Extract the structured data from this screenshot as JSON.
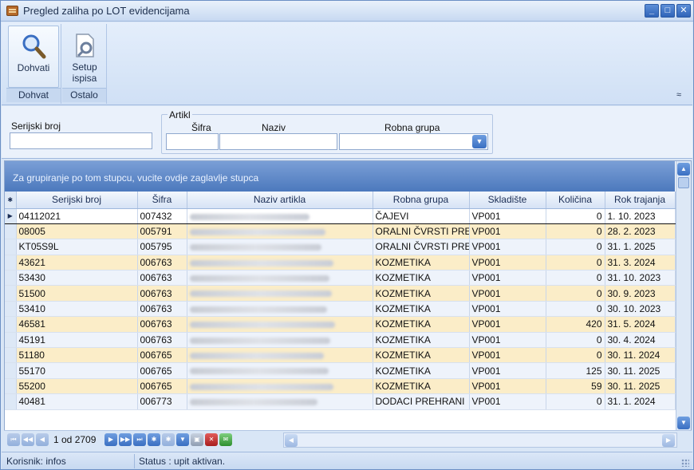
{
  "window": {
    "title": "Pregled zaliha po LOT evidencijama"
  },
  "ribbon": {
    "groups": [
      {
        "label": "Dohvat",
        "buttons": [
          {
            "label": "Dohvati",
            "icon": "magnifier-icon"
          }
        ]
      },
      {
        "label": "Ostalo",
        "buttons": [
          {
            "label": "Setup ispisa",
            "icon": "page-setup-icon"
          }
        ]
      }
    ],
    "collapse_glyph": "≈"
  },
  "filters": {
    "serijski_label": "Serijski broj",
    "serijski_value": "",
    "artikl_label": "Artikl",
    "sifra_label": "Šifra",
    "sifra_value": "",
    "naziv_label": "Naziv",
    "naziv_value": "",
    "grupa_label": "Robna grupa",
    "grupa_value": ""
  },
  "grid": {
    "group_hint": "Za grupiranje po tom stupcu, vucite ovdje zaglavlje stupca",
    "columns": [
      "Serijski broj",
      "Šifra",
      "Naziv artikla",
      "Robna grupa",
      "Skladište",
      "Količina",
      "Rok trajanja"
    ],
    "rows": [
      {
        "serijski": "04112021",
        "sifra": "007432",
        "grupa": "ČAJEVI",
        "skladiste": "VP001",
        "kolicina": "0",
        "rok": "1. 10. 2023"
      },
      {
        "serijski": "08005",
        "sifra": "005791",
        "grupa": "ORALNI ČVRSTI PREPA",
        "skladiste": "VP001",
        "kolicina": "0",
        "rok": "28. 2. 2023"
      },
      {
        "serijski": "KT05S9L",
        "sifra": "005795",
        "grupa": "ORALNI ČVRSTI PREPA",
        "skladiste": "VP001",
        "kolicina": "0",
        "rok": "31. 1. 2025"
      },
      {
        "serijski": "43621",
        "sifra": "006763",
        "grupa": "KOZMETIKA",
        "skladiste": "VP001",
        "kolicina": "0",
        "rok": "31. 3. 2024"
      },
      {
        "serijski": "53430",
        "sifra": "006763",
        "grupa": "KOZMETIKA",
        "skladiste": "VP001",
        "kolicina": "0",
        "rok": "31. 10. 2023"
      },
      {
        "serijski": "51500",
        "sifra": "006763",
        "grupa": "KOZMETIKA",
        "skladiste": "VP001",
        "kolicina": "0",
        "rok": "30. 9. 2023"
      },
      {
        "serijski": "53410",
        "sifra": "006763",
        "grupa": "KOZMETIKA",
        "skladiste": "VP001",
        "kolicina": "0",
        "rok": "30. 10. 2023"
      },
      {
        "serijski": "46581",
        "sifra": "006763",
        "grupa": "KOZMETIKA",
        "skladiste": "VP001",
        "kolicina": "420",
        "rok": "31. 5. 2024"
      },
      {
        "serijski": "45191",
        "sifra": "006763",
        "grupa": "KOZMETIKA",
        "skladiste": "VP001",
        "kolicina": "0",
        "rok": "30. 4. 2024"
      },
      {
        "serijski": "51180",
        "sifra": "006765",
        "grupa": "KOZMETIKA",
        "skladiste": "VP001",
        "kolicina": "0",
        "rok": "30. 11. 2024"
      },
      {
        "serijski": "55170",
        "sifra": "006765",
        "grupa": "KOZMETIKA",
        "skladiste": "VP001",
        "kolicina": "125",
        "rok": "30. 11. 2025"
      },
      {
        "serijski": "55200",
        "sifra": "006765",
        "grupa": "KOZMETIKA",
        "skladiste": "VP001",
        "kolicina": "59",
        "rok": "30. 11. 2025"
      },
      {
        "serijski": "40481",
        "sifra": "006773",
        "grupa": "DODACI PREHRANI",
        "skladiste": "VP001",
        "kolicina": "0",
        "rok": "31. 1. 2024"
      }
    ]
  },
  "pager": {
    "position": "1 od 2709"
  },
  "status": {
    "user": "Korisnik: infos",
    "state": "Status : upit aktivan."
  },
  "colors": {
    "accent": "#4c79bd",
    "row_alt": "#fbedc8",
    "row_norm": "#eef3fb"
  }
}
